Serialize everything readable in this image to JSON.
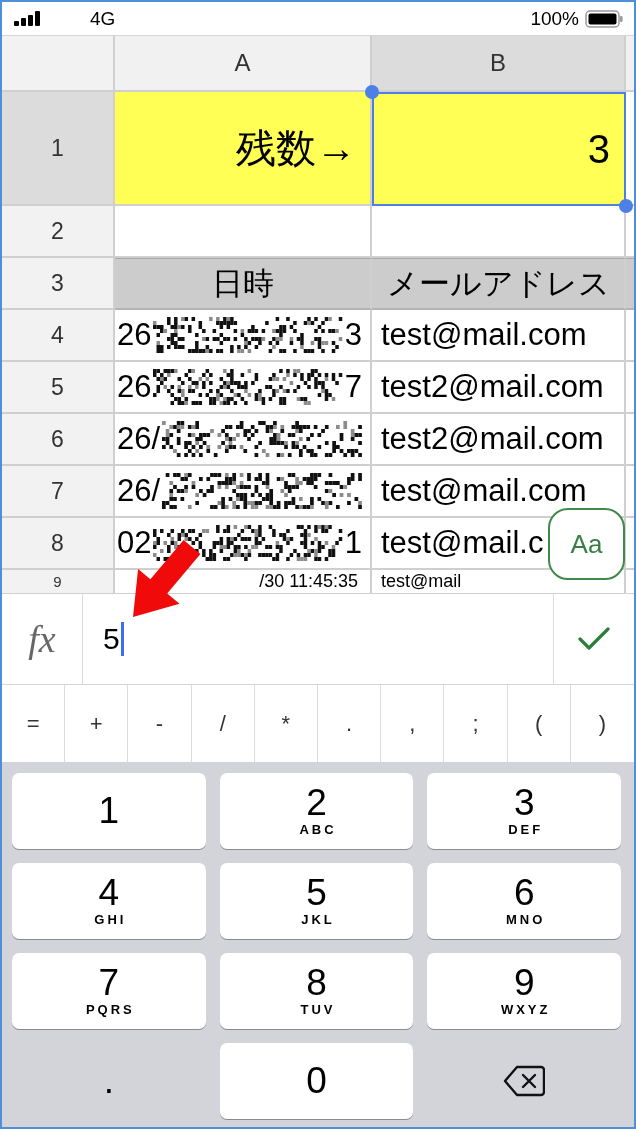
{
  "status_bar": {
    "network": "4G",
    "battery": "100%"
  },
  "sheet": {
    "columns": [
      {
        "label": "A",
        "selected": false
      },
      {
        "label": "B",
        "selected": true
      }
    ],
    "rows": [
      {
        "number": "1",
        "selected": true,
        "kind": "highlight",
        "cells": [
          {
            "text": "残数→",
            "selected": false
          },
          {
            "text": "3",
            "selected": true
          }
        ]
      },
      {
        "number": "2",
        "selected": false,
        "kind": "blank",
        "cells": [
          {
            "selected": false
          },
          {
            "selected": false
          }
        ]
      },
      {
        "number": "3",
        "selected": false,
        "kind": "header",
        "cells": [
          {
            "text": "日時",
            "selected": false
          },
          {
            "text": "メールアドレス",
            "selected": false
          }
        ]
      },
      {
        "number": "4",
        "selected": false,
        "kind": "record",
        "cells": [
          {
            "text_start": "26",
            "text_end": "3",
            "redacted": true,
            "selected": false
          },
          {
            "text": "test@mail.com",
            "selected": false
          }
        ]
      },
      {
        "number": "5",
        "selected": false,
        "kind": "record",
        "cells": [
          {
            "text_start": "26",
            "text_end": "7",
            "redacted": true,
            "selected": false
          },
          {
            "text": "test2@mail.com",
            "selected": false
          }
        ]
      },
      {
        "number": "6",
        "selected": false,
        "kind": "record",
        "cells": [
          {
            "text_start": "26/",
            "redacted": true,
            "selected": false
          },
          {
            "text": "test2@mail.com",
            "selected": false
          }
        ]
      },
      {
        "number": "7",
        "selected": false,
        "kind": "record",
        "cells": [
          {
            "text_start": "26/",
            "redacted": true,
            "selected": false
          },
          {
            "text": "test@mail.com",
            "selected": false
          }
        ]
      },
      {
        "number": "8",
        "selected": false,
        "kind": "record",
        "cells": [
          {
            "text_start": "02",
            "text_end": "1",
            "redacted": true,
            "selected": false
          },
          {
            "text": "test@mail.c",
            "selected": false
          }
        ]
      },
      {
        "number": "9",
        "selected": false,
        "kind": "record",
        "cells": [
          {
            "text": "/30 11:45:35",
            "selected": false
          },
          {
            "text": "test@mail",
            "selected": false
          }
        ]
      }
    ]
  },
  "format_button": {
    "label": "Aa"
  },
  "formula_bar": {
    "label": "fx",
    "value": "5"
  },
  "symbol_keys": [
    "=",
    "+",
    "-",
    "/",
    "*",
    ".",
    ",",
    ";",
    "(",
    ")"
  ],
  "keypad": [
    {
      "kind": "digit",
      "digit": "1"
    },
    {
      "kind": "digit",
      "digit": "2",
      "letters": "ABC"
    },
    {
      "kind": "digit",
      "digit": "3",
      "letters": "DEF"
    },
    {
      "kind": "digit",
      "digit": "4",
      "letters": "GHI"
    },
    {
      "kind": "digit",
      "digit": "5",
      "letters": "JKL"
    },
    {
      "kind": "digit",
      "digit": "6",
      "letters": "MNO"
    },
    {
      "kind": "digit",
      "digit": "7",
      "letters": "PQRS"
    },
    {
      "kind": "digit",
      "digit": "8",
      "letters": "TUV"
    },
    {
      "kind": "digit",
      "digit": "9",
      "letters": "WXYZ"
    },
    {
      "kind": "plain",
      "digit": "."
    },
    {
      "kind": "digit",
      "digit": "0"
    },
    {
      "kind": "backspace"
    }
  ]
}
